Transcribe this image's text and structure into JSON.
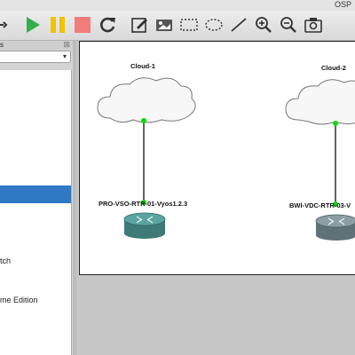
{
  "window": {
    "title": "OSP"
  },
  "sidebar": {
    "header": "s",
    "close_glyph": "⊠",
    "items": [
      {
        "label": "tch"
      },
      {
        "label": "me Edition"
      }
    ]
  },
  "topology": {
    "nodes": [
      {
        "label": "Cloud-1",
        "type": "cloud"
      },
      {
        "label": "Cloud-2",
        "type": "cloud"
      },
      {
        "label": "PRO-VSO-RTR-01-Vyos1.2.3",
        "type": "router"
      },
      {
        "label": "BWI-VDC-RTR-03-V",
        "type": "router"
      }
    ]
  },
  "colors": {
    "selection": "#2f78c4",
    "link_endpoint": "#00e000",
    "play": "#2fb04a",
    "pause": "#f2c200",
    "stop": "#f27c7c",
    "router_teal": "#4b8f8c",
    "router_gray": "#6d8288"
  },
  "icons": [
    "cut-icon",
    "play-icon",
    "pause-icon",
    "stop-icon",
    "reload-icon",
    "note-icon",
    "image-icon",
    "rectangle-icon",
    "ellipse-icon",
    "line-icon",
    "zoom-in-icon",
    "zoom-out-icon",
    "screenshot-icon"
  ]
}
